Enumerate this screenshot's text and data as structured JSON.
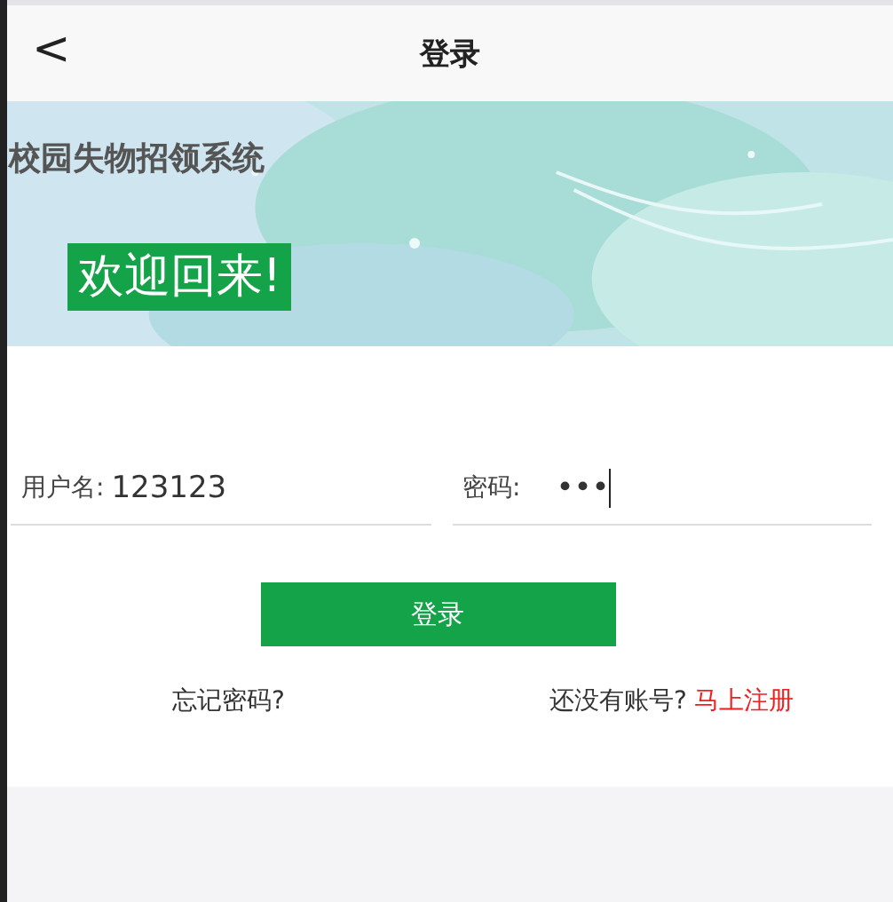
{
  "header": {
    "back": "<",
    "title": "登录"
  },
  "banner": {
    "kind": "picture",
    "system_name": "校园失物招领系统",
    "welcome": "欢迎回来!"
  },
  "form": {
    "fields": [
      {
        "label": "用户名:",
        "value": "123123"
      },
      {
        "label": "密码:",
        "value": "•••",
        "focused": true
      }
    ],
    "submit": "登录"
  },
  "links": {
    "forgot": "忘记密码?",
    "no_account": "还没有账号?",
    "register": "马上注册"
  }
}
